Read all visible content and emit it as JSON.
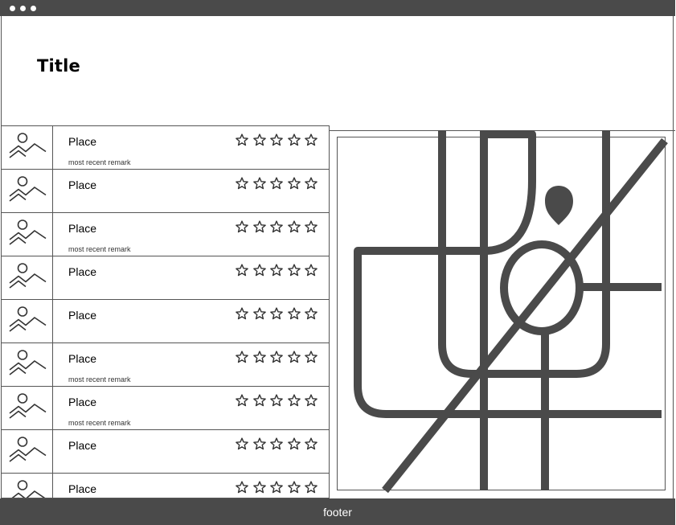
{
  "window": {
    "controls": [
      "close",
      "minimize",
      "maximize"
    ]
  },
  "header": {
    "title": "Title"
  },
  "list": {
    "items": [
      {
        "label": "Place",
        "remark": "most recent remark",
        "rating": 0,
        "max_rating": 5,
        "thumbnail": "image-placeholder-icon"
      },
      {
        "label": "Place",
        "remark": "",
        "rating": 0,
        "max_rating": 5,
        "thumbnail": "image-placeholder-icon"
      },
      {
        "label": "Place",
        "remark": "most recent remark",
        "rating": 0,
        "max_rating": 5,
        "thumbnail": "image-placeholder-icon"
      },
      {
        "label": "Place",
        "remark": "",
        "rating": 0,
        "max_rating": 5,
        "thumbnail": "image-placeholder-icon"
      },
      {
        "label": "Place",
        "remark": "",
        "rating": 0,
        "max_rating": 5,
        "thumbnail": "image-placeholder-icon"
      },
      {
        "label": "Place",
        "remark": "most recent remark",
        "rating": 0,
        "max_rating": 5,
        "thumbnail": "image-placeholder-icon"
      },
      {
        "label": "Place",
        "remark": "most recent remark",
        "rating": 0,
        "max_rating": 5,
        "thumbnail": "image-placeholder-icon"
      },
      {
        "label": "Place",
        "remark": "",
        "rating": 0,
        "max_rating": 5,
        "thumbnail": "image-placeholder-icon"
      },
      {
        "label": "Place",
        "remark": "",
        "rating": 0,
        "max_rating": 5,
        "thumbnail": "image-placeholder-icon"
      }
    ]
  },
  "map": {
    "icon": "map-placeholder-icon",
    "marker": "location-pin-icon"
  },
  "footer": {
    "text": "footer"
  },
  "colors": {
    "chrome": "#4a4a4a",
    "line": "#555555",
    "background": "#ffffff",
    "footer_text": "#ffffff"
  }
}
